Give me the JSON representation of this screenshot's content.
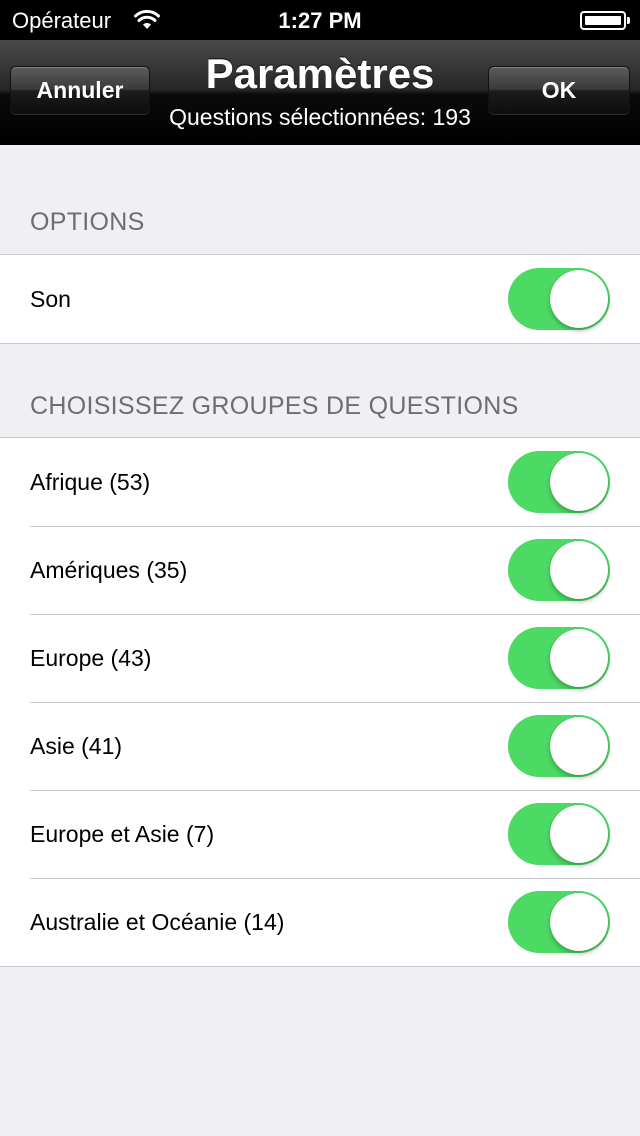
{
  "status_bar": {
    "carrier": "Opérateur",
    "time": "1:27 PM",
    "wifi_icon": "wifi-icon",
    "battery_icon": "battery-icon"
  },
  "nav": {
    "title": "Paramètres",
    "subtitle": "Questions sélectionnées: 193",
    "cancel_label": "Annuler",
    "ok_label": "OK"
  },
  "options": {
    "header": "OPTIONS",
    "items": [
      {
        "label": "Son",
        "on": true
      }
    ]
  },
  "groups": {
    "header": "CHOISISSEZ GROUPES DE QUESTIONS",
    "items": [
      {
        "label": "Afrique (53)",
        "on": true
      },
      {
        "label": "Amériques (35)",
        "on": true
      },
      {
        "label": "Europe (43)",
        "on": true
      },
      {
        "label": "Asie (41)",
        "on": true
      },
      {
        "label": "Europe et Asie (7)",
        "on": true
      },
      {
        "label": "Australie et Océanie (14)",
        "on": true
      }
    ]
  },
  "colors": {
    "switch_on": "#4cd964",
    "background": "#efeff4"
  }
}
